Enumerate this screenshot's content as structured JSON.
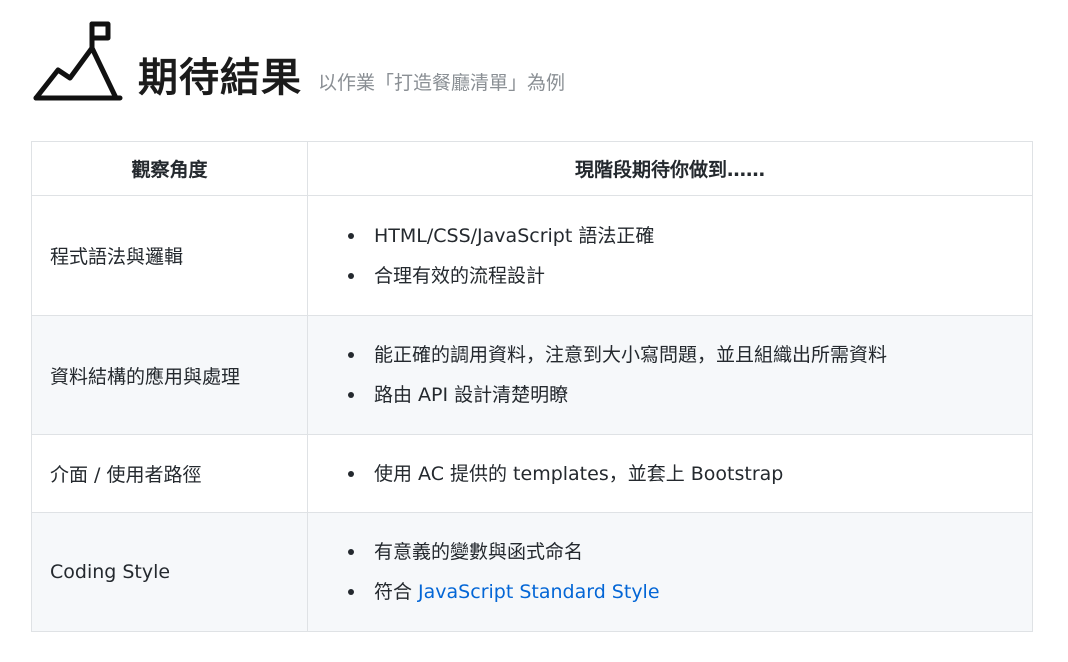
{
  "header": {
    "icon": "mountain-flag-icon",
    "title": "期待結果",
    "subtitle": "以作業「打造餐廳清單」為例"
  },
  "table": {
    "columns": [
      "觀察角度",
      "現階段期待你做到……"
    ],
    "rows": [
      {
        "aspect": "程式語法與邏輯",
        "items": [
          "HTML/CSS/JavaScript 語法正確",
          "合理有效的流程設計"
        ]
      },
      {
        "aspect": "資料結構的應用與處理",
        "items": [
          "能正確的調用資料，注意到大小寫問題，並且組織出所需資料",
          "路由 API 設計清楚明瞭"
        ]
      },
      {
        "aspect": "介面 / 使用者路徑",
        "items": [
          "使用 AC 提供的 templates，並套上 Bootstrap"
        ]
      },
      {
        "aspect": "Coding Style",
        "items": [
          "有意義的變數與函式命名"
        ],
        "link_item": {
          "prefix": "符合 ",
          "link_text": "JavaScript Standard Style"
        }
      }
    ]
  },
  "colors": {
    "link": "#0366d6",
    "border": "#dfe2e5",
    "row_shade": "#f6f8fa",
    "subtitle": "#8a8f94"
  }
}
